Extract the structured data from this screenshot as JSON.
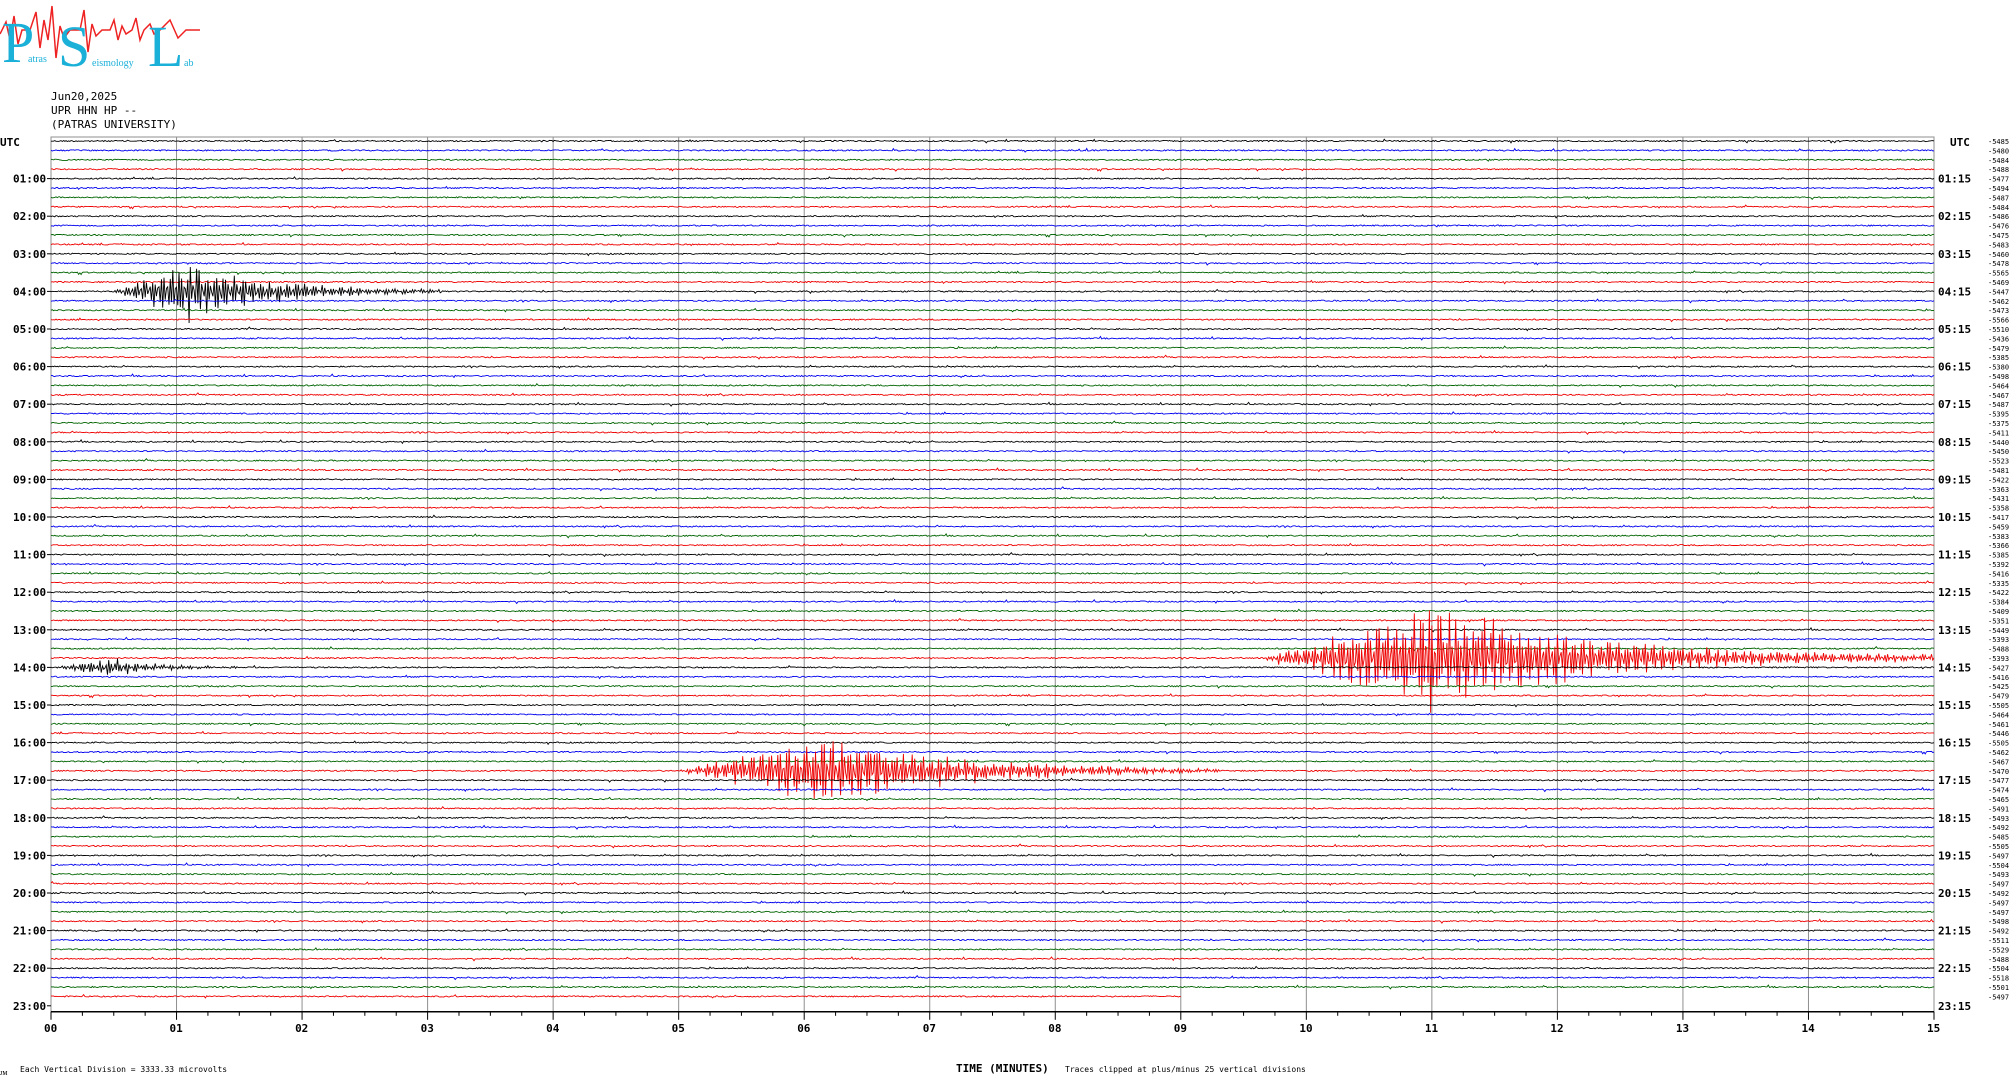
{
  "logo": {
    "letters": [
      "P",
      "S",
      "L"
    ],
    "words": [
      "atras",
      "eismology",
      "ab"
    ]
  },
  "header": {
    "date": "Jun20,2025",
    "station": "UPR HHN HP --",
    "institution": "(PATRAS UNIVERSITY)"
  },
  "axis": {
    "left_title": "UTC",
    "right_title": "UTC",
    "xlabel": "TIME (MINUTES)"
  },
  "footer": {
    "division_note": "Each Vertical Division = 3333.33 microvolts",
    "clip_note": "Traces clipped at plus/minus 25 vertical divisions",
    "corner_mark": "ᴊᴍ"
  },
  "colors": {
    "black": "#000000",
    "red": "#ee0000",
    "blue": "#0000ee",
    "green": "#006400",
    "grid": "#8f8f8f"
  },
  "chart_data": {
    "type": "line",
    "title": "",
    "xlabel": "TIME (MINUTES)",
    "ylabel": "UTC",
    "xlim": [
      0,
      15
    ],
    "x_ticks": [
      "00",
      "01",
      "02",
      "03",
      "04",
      "05",
      "06",
      "07",
      "08",
      "09",
      "10",
      "11",
      "12",
      "13",
      "14",
      "15"
    ],
    "hour_labels_left": [
      "01:00",
      "02:00",
      "03:00",
      "04:00",
      "05:00",
      "06:00",
      "07:00",
      "08:00",
      "09:00",
      "10:00",
      "11:00",
      "12:00",
      "13:00",
      "14:00",
      "15:00",
      "16:00",
      "17:00",
      "18:00",
      "19:00",
      "20:00",
      "21:00",
      "22:00",
      "23:00"
    ],
    "hour_labels_right": [
      "01:15",
      "02:15",
      "03:15",
      "04:15",
      "05:15",
      "06:15",
      "07:15",
      "08:15",
      "09:15",
      "10:15",
      "11:15",
      "12:15",
      "13:15",
      "14:15",
      "15:15",
      "16:15",
      "17:15",
      "18:15",
      "19:15",
      "20:15",
      "21:15",
      "22:15",
      "23:15"
    ],
    "trace_colors_cycle": [
      "black",
      "blue",
      "green",
      "red"
    ],
    "trace_count": 92,
    "last_trace_end_minute": 9,
    "trace_offsets": [
      "-5485",
      "-5480",
      "-5484",
      "-5488",
      "-5477",
      "-5494",
      "-5487",
      "-5484",
      "-5486",
      "-5476",
      "-5475",
      "-5483",
      "-5460",
      "-5478",
      "-5565",
      "-5469",
      "-5447",
      "-5462",
      "-5473",
      "-5566",
      "-5510",
      "-5436",
      "-5479",
      "-5385",
      "-5380",
      "-5498",
      "-5464",
      "-5467",
      "-5487",
      "-5395",
      "-5375",
      "-5411",
      "-5440",
      "-5450",
      "-5523",
      "-5481",
      "-5422",
      "-5363",
      "-5431",
      "-5358",
      "-5417",
      "-5459",
      "-5383",
      "-5366",
      "-5385",
      "-5392",
      "-5416",
      "-5335",
      "-5422",
      "-5384",
      "-5409",
      "-5351",
      "-5449",
      "-5393",
      "-5488",
      "-5393",
      "-5427",
      "-5416",
      "-5425",
      "-5479",
      "-5505",
      "-5464",
      "-5461",
      "-5446",
      "-5505",
      "-5462",
      "-5467",
      "-5470",
      "-5477",
      "-5474",
      "-5465",
      "-5491",
      "-5493",
      "-5492",
      "-5485",
      "-5505",
      "-5497",
      "-5504",
      "-5493",
      "-5497",
      "-5492",
      "-5497",
      "-5497",
      "-5498",
      "-5492",
      "-5511",
      "-5529",
      "-5488",
      "-5504",
      "-5518",
      "-5501",
      "-5497"
    ],
    "events": [
      {
        "trace": 16,
        "start_min": 0.48,
        "peak_min": 1.1,
        "end_min": 3.1,
        "amplitude_div": 5
      },
      {
        "trace": 67,
        "start_min": 5.0,
        "peak_min": 6.2,
        "end_min": 9.3,
        "amplitude_div": 6
      },
      {
        "trace": 55,
        "start_min": 9.65,
        "peak_min": 11.0,
        "end_min": 15.0,
        "amplitude_div": 9
      },
      {
        "trace": 56,
        "start_min": 0.0,
        "peak_min": 0.5,
        "end_min": 1.5,
        "amplitude_div": 1.5
      }
    ]
  }
}
